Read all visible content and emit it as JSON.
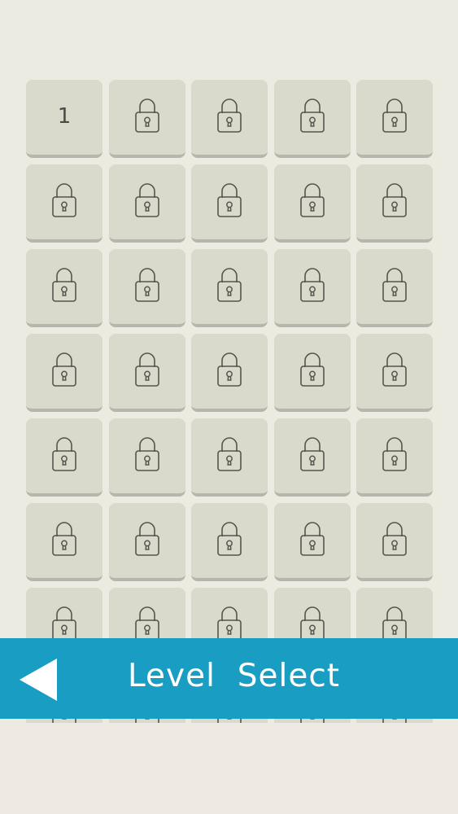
{
  "screen": {
    "title": "Level  Select",
    "back_icon": "back-triangle-icon"
  },
  "grid": {
    "columns": 5,
    "visible_rows": 8,
    "tiles": [
      {
        "number": "1",
        "locked": false
      },
      {
        "locked": true
      },
      {
        "locked": true
      },
      {
        "locked": true
      },
      {
        "locked": true
      },
      {
        "locked": true
      },
      {
        "locked": true
      },
      {
        "locked": true
      },
      {
        "locked": true
      },
      {
        "locked": true
      },
      {
        "locked": true
      },
      {
        "locked": true
      },
      {
        "locked": true
      },
      {
        "locked": true
      },
      {
        "locked": true
      },
      {
        "locked": true
      },
      {
        "locked": true
      },
      {
        "locked": true
      },
      {
        "locked": true
      },
      {
        "locked": true
      },
      {
        "locked": true
      },
      {
        "locked": true
      },
      {
        "locked": true
      },
      {
        "locked": true
      },
      {
        "locked": true
      },
      {
        "locked": true
      },
      {
        "locked": true
      },
      {
        "locked": true
      },
      {
        "locked": true
      },
      {
        "locked": true
      },
      {
        "locked": true
      },
      {
        "locked": true
      },
      {
        "locked": true
      },
      {
        "locked": true
      },
      {
        "locked": true
      },
      {
        "locked": true
      },
      {
        "locked": true
      },
      {
        "locked": true
      },
      {
        "locked": true
      },
      {
        "locked": true
      }
    ],
    "lock_icon": "padlock-icon"
  },
  "colors": {
    "background": "#ECEBE2",
    "tile": "#D9D9CC",
    "tile_shadow": "#B7B6AA",
    "lock_stroke": "#55554F",
    "bar": "#1A9DC3",
    "bar_text": "#FFFFFF"
  }
}
